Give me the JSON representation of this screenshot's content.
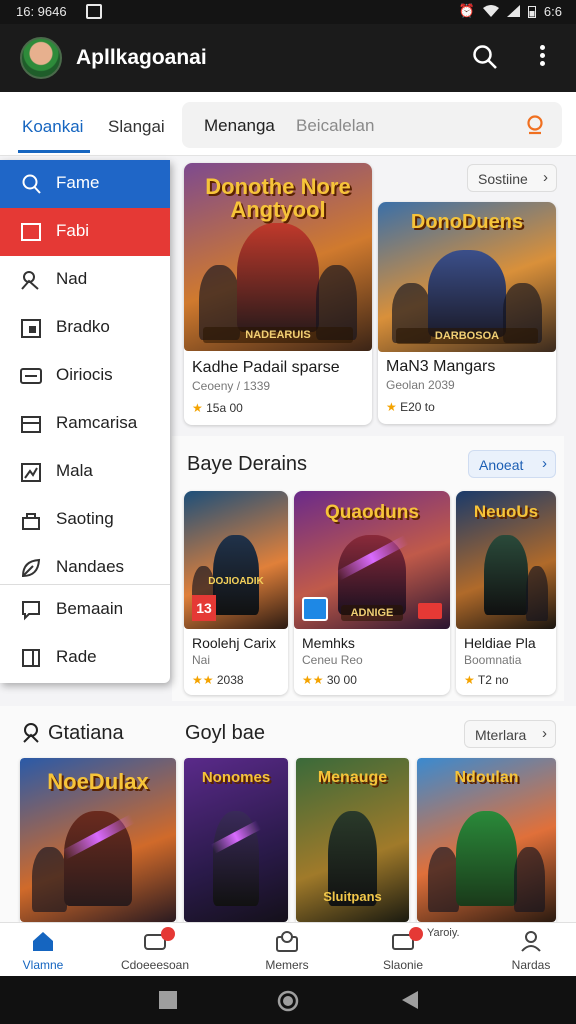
{
  "status_bar": {
    "time": "16: 9646",
    "right_text": "6:6"
  },
  "app_bar": {
    "title": "Apllkagoanai"
  },
  "tabs": [
    {
      "label": "Koankai"
    },
    {
      "label": "Slangai"
    }
  ],
  "search": {
    "chip": "Menanga",
    "placeholder": "Beicalelan"
  },
  "drawer": {
    "items": [
      {
        "label": "Fame",
        "icon": "search-icon",
        "style": "blue"
      },
      {
        "label": "Fabi",
        "icon": "square-icon",
        "style": "red"
      },
      {
        "label": "Nad",
        "icon": "people-icon"
      },
      {
        "label": "Bradko",
        "icon": "calendar-icon"
      },
      {
        "label": "Oiriocis",
        "icon": "list-icon"
      },
      {
        "label": "Ramcarisa",
        "icon": "folder-icon"
      },
      {
        "label": "Mala",
        "icon": "image-icon"
      },
      {
        "label": "Saoting",
        "icon": "lock-icon"
      },
      {
        "label": "Nandaes",
        "icon": "leaf-icon"
      },
      {
        "label": "Bemaain",
        "icon": "chat-icon"
      },
      {
        "label": "Rade",
        "icon": "book-icon"
      }
    ]
  },
  "featured": {
    "pill": "Sostiine",
    "cards": [
      {
        "title": "Kadhe Padail sparse",
        "subtitle": "Ceoeny / 1339",
        "rating": "15a 00",
        "art_title": "Donothe Nore Angtyool",
        "art_sub": "NADEARUIS",
        "theme": "warm"
      },
      {
        "title": "MaN3 Mangars",
        "subtitle": "Geolan 2039",
        "rating": "E20 to",
        "art_title": "DonoDuens",
        "art_sub": "DARBOSOA",
        "theme": "blue"
      }
    ]
  },
  "section2": {
    "heading": "Baye Derains",
    "pill": "Anoeat",
    "cards": [
      {
        "title": "Roolehj Carix",
        "subtitle": "Nai",
        "rating": "2038",
        "art_title": "",
        "art_sub": "DOJIOADIK",
        "theme": "dusk",
        "badge": "13"
      },
      {
        "title": "Memhks",
        "subtitle": "Ceneu Reo",
        "rating": "30 00",
        "art_title": "Quaoduns",
        "art_sub": "ADNIGE",
        "theme": "purple"
      },
      {
        "title": "Heldiae Pla",
        "subtitle": "Boomnatia",
        "rating": "T2 no",
        "art_title": "NeuoUs",
        "art_sub": "",
        "theme": "night"
      }
    ]
  },
  "section3": {
    "heading_left": "Gtatiana",
    "heading_mid": "Goyl bae",
    "pill": "Mterlara",
    "covers": [
      {
        "art_title": "NoeDulax",
        "theme": "blue"
      },
      {
        "art_title": "Nonomes",
        "theme": "purple"
      },
      {
        "art_title": "Menauge",
        "art_sub": "Sluitpans",
        "theme": "green"
      },
      {
        "art_title": "Ndoulan",
        "theme": "sky"
      }
    ]
  },
  "bottom_nav": [
    {
      "label": "Vlamne",
      "icon": "home-icon",
      "active": true
    },
    {
      "label": "Cdoeeesoan",
      "icon": "gamepad-icon",
      "badge": true
    },
    {
      "label": "Memers",
      "icon": "inbox-icon"
    },
    {
      "label": "Slaonie",
      "icon": "chat-icon",
      "badge": true,
      "top_text": "Yaroiy."
    },
    {
      "label": "Nardas",
      "icon": "profile-icon"
    }
  ],
  "colors": {
    "accent": "#1565c0",
    "danger": "#e53935",
    "appbar": "#1b1b1b",
    "star": "#f4a300"
  }
}
